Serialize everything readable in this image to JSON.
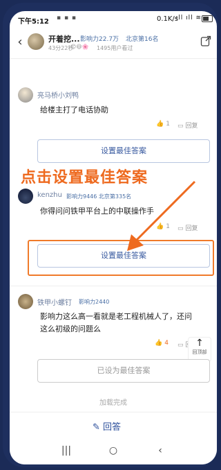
{
  "status": {
    "time": "下午5:12",
    "net_speed": "0.1K/s",
    "status_icons": "▪ ▪ ▪",
    "signal_icons": "ıll ıll ≋"
  },
  "header": {
    "title": "开着挖...",
    "influence": "影响力22.7万",
    "rank": "北京第16名",
    "time_ago": "43分22秒",
    "emoji_row": "😊😄🌸",
    "viewers": "1495用户看过"
  },
  "comments": [
    {
      "name": "亮马桥小刘鸭",
      "badge": "",
      "text": "给楼主打了电话协助",
      "likes": "1",
      "reply_label": "回复",
      "button_label": "设置最佳答案"
    },
    {
      "name": "kenzhu",
      "badge": "影响力9446 北京第335名",
      "text": "你得问问铁甲平台上的中联操作手",
      "likes": "1",
      "reply_label": "回复",
      "button_label": "设置最佳答案"
    },
    {
      "name": "铁甲小螺钉",
      "badge": "影响力2440",
      "text_line1": "影响力这么高一看就是老工程机械人了，还问",
      "text_line2": "这么初级的问题么",
      "likes": "4",
      "reply_label": "回复",
      "button_label": "已设为最佳答案"
    }
  ],
  "annotation": {
    "callout": "点击设置最佳答案",
    "color": "#ee6a1f"
  },
  "back_to_top": {
    "arrow": "↑",
    "label": "回顶部"
  },
  "loading_text": "加载完成",
  "answer_bar": {
    "icon": "✎",
    "label": "回答"
  },
  "nav": {
    "menu": "|||",
    "home": "○",
    "back": "‹"
  }
}
